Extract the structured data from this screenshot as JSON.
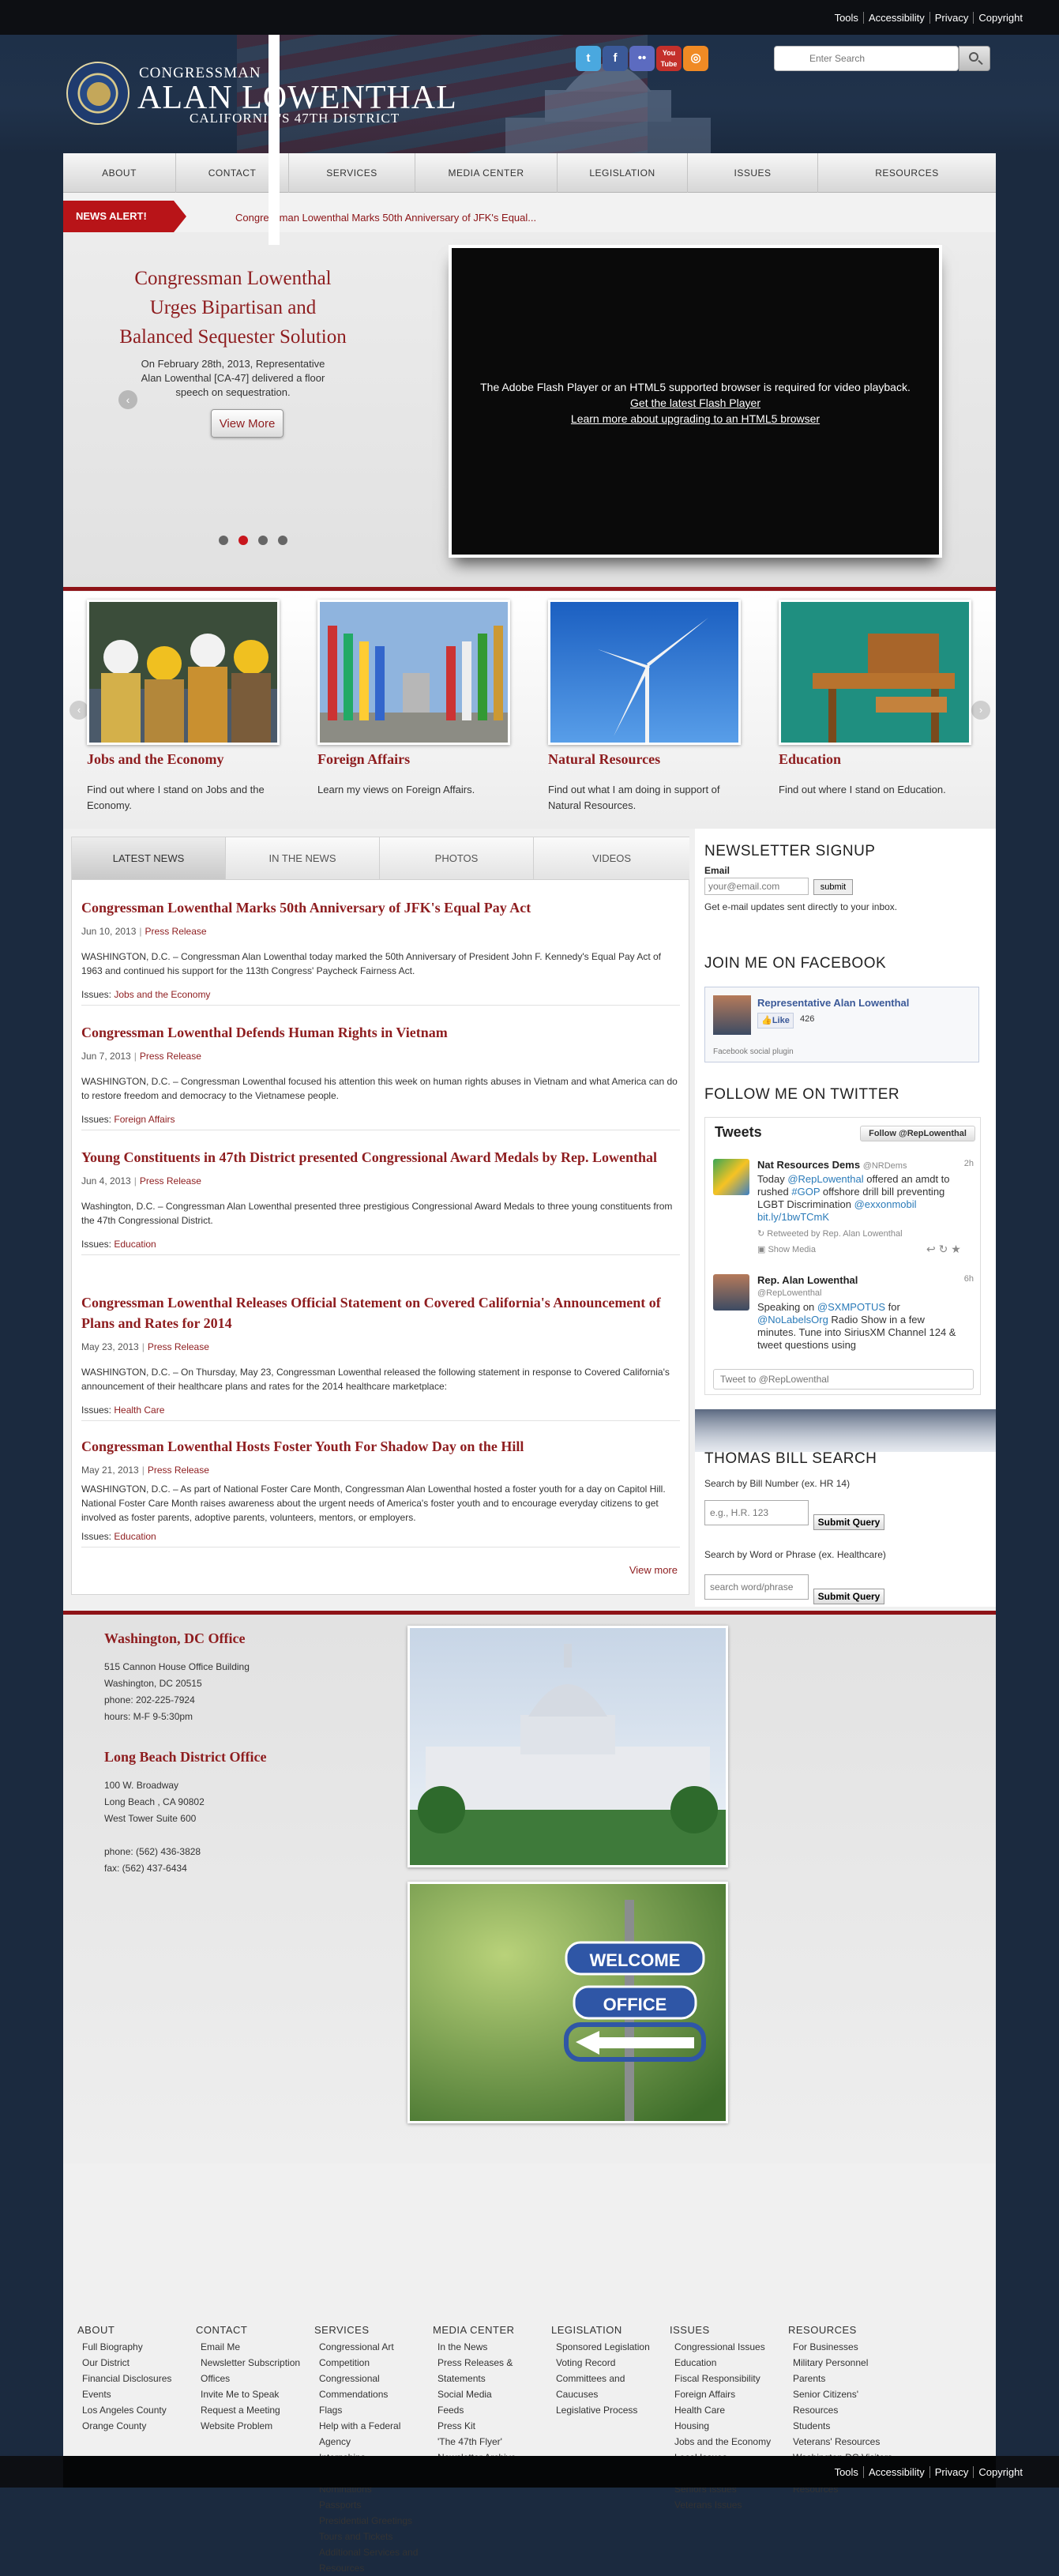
{
  "utility": {
    "tools": "Tools",
    "accessibility": "Accessibility",
    "privacy": "Privacy",
    "copyright": "Copyright"
  },
  "header": {
    "congressman": "CONGRESSMAN",
    "name": "ALAN LOWENTHAL",
    "district": "CALIFORNIA'S 47TH DISTRICT",
    "seal_icon": "house-seal-icon",
    "social": {
      "twitter": "t",
      "facebook": "f",
      "flickr": "••",
      "youtube": "You Tube",
      "rss": "◎"
    },
    "search": {
      "placeholder": "Enter Search"
    }
  },
  "nav": [
    "ABOUT",
    "CONTACT",
    "SERVICES",
    "MEDIA CENTER",
    "LEGISLATION",
    "ISSUES",
    "RESOURCES"
  ],
  "alert": {
    "label": "NEWS ALERT!",
    "text": "Congressman Lowenthal Marks 50th Anniversary of JFK's Equal..."
  },
  "hero": {
    "title": "Congressman Lowenthal Urges Bipartisan and Balanced Sequester Solution",
    "text": "On February 28th, 2013, Representative Alan Lowenthal [CA-47] delivered a floor speech on sequestration.",
    "button": "View More",
    "prev": "‹",
    "video_line1": "The Adobe Flash Player or an HTML5 supported browser is required for video playback.",
    "video_line2": "Get the latest Flash Player",
    "video_line3": "Learn more about upgrading to an HTML5 browser",
    "active_slide": 2
  },
  "features": [
    {
      "title": "Jobs and the Economy",
      "text": "Find out where I stand on Jobs and the Economy."
    },
    {
      "title": "Foreign Affairs",
      "text": "Learn my views on Foreign Affairs."
    },
    {
      "title": "Natural Resources",
      "text": "Find out what I am doing in support of Natural Resources."
    },
    {
      "title": "Education",
      "text": "Find out where I stand on Education."
    }
  ],
  "tabs": [
    "LATEST NEWS",
    "IN THE NEWS",
    "PHOTOS",
    "VIDEOS"
  ],
  "articles": [
    {
      "title": "Congressman Lowenthal Marks 50th Anniversary of JFK's Equal Pay Act",
      "date": "Jun 10, 2013",
      "category": "Press Release",
      "body": "WASHINGTON, D.C. – Congressman Alan Lowenthal today marked the 50th Anniversary of President John F. Kennedy's Equal Pay Act of 1963 and continued his support for the 113th Congress' Paycheck Fairness Act.",
      "issues_label": "Issues:",
      "issue": "Jobs and the Economy"
    },
    {
      "title": "Congressman Lowenthal Defends Human Rights in Vietnam",
      "date": "Jun 7, 2013",
      "category": "Press Release",
      "body": "WASHINGTON, D.C. – Congressman Lowenthal focused his attention this week on human rights abuses in Vietnam and what America can do to restore freedom and democracy to the Vietnamese people.",
      "issues_label": "Issues:",
      "issue": "Foreign Affairs"
    },
    {
      "title": "Young Constituents in 47th District presented Congressional Award Medals by Rep. Lowenthal",
      "date": "Jun 4, 2013",
      "category": "Press Release",
      "body": "Washington, D.C. – Congressman Alan Lowenthal presented three prestigious Congressional Award Medals to three young constituents from the 47th Congressional District.",
      "issues_label": "Issues:",
      "issue": "Education"
    },
    {
      "title": "Congressman Lowenthal Releases Official Statement on Covered California's Announcement of Plans and Rates for 2014",
      "date": "May 23, 2013",
      "category": "Press Release",
      "body": "WASHINGTON, D.C. – On Thursday, May 23, Congressman Lowenthal released the following statement in response to Covered California's announcement of their healthcare plans and rates for the 2014 healthcare marketplace:",
      "issues_label": "Issues:",
      "issue": "Health Care"
    },
    {
      "title": "Congressman Lowenthal Hosts Foster Youth For Shadow Day on the Hill",
      "date": "May 21, 2013",
      "category": "Press Release",
      "body": "WASHINGTON, D.C. – As part of National Foster Care Month, Congressman Alan Lowenthal hosted a foster youth for a day on Capitol Hill. National Foster Care Month raises awareness about the urgent needs of America's foster youth and to encourage everyday citizens to get involved as foster parents, adoptive parents, volunteers, mentors, or employers.",
      "issues_label": "Issues:",
      "issue": "Education"
    }
  ],
  "view_more": "View more",
  "sidebar": {
    "newsletter_title": "NEWSLETTER SIGNUP",
    "email_label": "Email",
    "email_placeholder": "your@email.com",
    "submit": "submit",
    "newsletter_note": "Get e-mail updates sent directly to your inbox.",
    "facebook_title": "JOIN ME ON FACEBOOK",
    "fb_name": "Representative Alan Lowenthal",
    "fb_like": "👍Like",
    "fb_count": "426",
    "fb_plugin": "Facebook social plugin",
    "twitter_title": "FOLLOW ME ON TWITTER",
    "tweets_label": "Tweets",
    "follow_label": "Follow @RepLowenthal",
    "tweet1": {
      "name": "Nat Resources Dems",
      "handle": "@NRDems",
      "time": "2h",
      "t1": "Today ",
      "l1": "@RepLowenthal",
      "t2": " offered an amdt to rushed ",
      "l2": "#GOP",
      "t3": " offshore drill bill preventing LGBT Discrimination ",
      "l3": "@exxonmobil bit.ly/1bwTCmK",
      "retweet": "Retweeted by Rep. Alan Lowenthal",
      "media": "Show Media"
    },
    "tweet2": {
      "name": "Rep. Alan Lowenthal",
      "handle": "@RepLowenthal",
      "time": "6h",
      "t1": "Speaking on ",
      "l1": "@SXMPOTUS",
      "t2": " for ",
      "l2": "@NoLabelsOrg",
      "t3": " Radio Show in a few minutes. Tune into SiriusXM Channel 124 & tweet questions using"
    },
    "tweet_placeholder": "Tweet to @RepLowenthal",
    "bill_title": "THOMAS BILL SEARCH",
    "bill_number_label": "Search by Bill Number (ex. HR 14)",
    "bill_number_placeholder": "e.g., H.R. 123",
    "bill_submit": "Submit Query",
    "bill_word_label": "Search by Word or Phrase (ex. Healthcare)",
    "bill_word_placeholder": "search word/phrase",
    "bill_submit2": "Submit Query"
  },
  "offices": {
    "dc_title": "Washington, DC Office",
    "dc_lines": [
      "515 Cannon House Office Building",
      "Washington, DC 20515",
      "phone: 202-225-7924",
      "hours: M-F 9-5:30pm"
    ],
    "lb_title": "Long Beach District Office",
    "lb_lines": [
      "100 W. Broadway",
      "Long Beach , CA 90802",
      "West Tower Suite 600",
      "",
      "phone: (562) 436-3828",
      "fax: (562) 437-6434"
    ],
    "sign_words": [
      "WELCOME",
      "OFFICE"
    ]
  },
  "footer": [
    {
      "heading": "ABOUT",
      "items": [
        "Full Biography",
        "Our District",
        "Financial Disclosures",
        "Events",
        "Los Angeles County",
        "Orange County"
      ]
    },
    {
      "heading": "CONTACT",
      "items": [
        "Email Me",
        "Newsletter Subscription",
        "Offices",
        "Invite Me to Speak",
        "Request a Meeting",
        "Website Problem"
      ]
    },
    {
      "heading": "SERVICES",
      "items": [
        "Congressional Art Competition",
        "Congressional Commendations",
        "Flags",
        "Help with a Federal Agency",
        "Internships",
        "Military Academy Nominations",
        "Passports",
        "Presidential Greetings",
        "Tours and Tickets",
        "Additional Services and Resources"
      ]
    },
    {
      "heading": "MEDIA CENTER",
      "items": [
        "In the News",
        "Press Releases & Statements",
        "Social Media",
        "Feeds",
        "Press Kit",
        "'The 47th Flyer' Newsletter Archive"
      ]
    },
    {
      "heading": "LEGISLATION",
      "items": [
        "Sponsored Legislation",
        "Voting Record",
        "Committees and Caucuses",
        "Legislative Process"
      ]
    },
    {
      "heading": "ISSUES",
      "items": [
        "Congressional Issues",
        "Education",
        "Fiscal Responsibility",
        "Foreign Affairs",
        "Health Care",
        "Housing",
        "Jobs and the Economy",
        "Local Issues",
        "Natural Resources",
        "Seniors Issues",
        "Veterans Issues"
      ]
    },
    {
      "heading": "RESOURCES",
      "items": [
        "For Businesses",
        "Military Personnel",
        "Parents",
        "Senior Citizens' Resources",
        "Students",
        "Veterans' Resources",
        "Washington DC Visitors",
        "Additional Services and Resources"
      ]
    }
  ]
}
